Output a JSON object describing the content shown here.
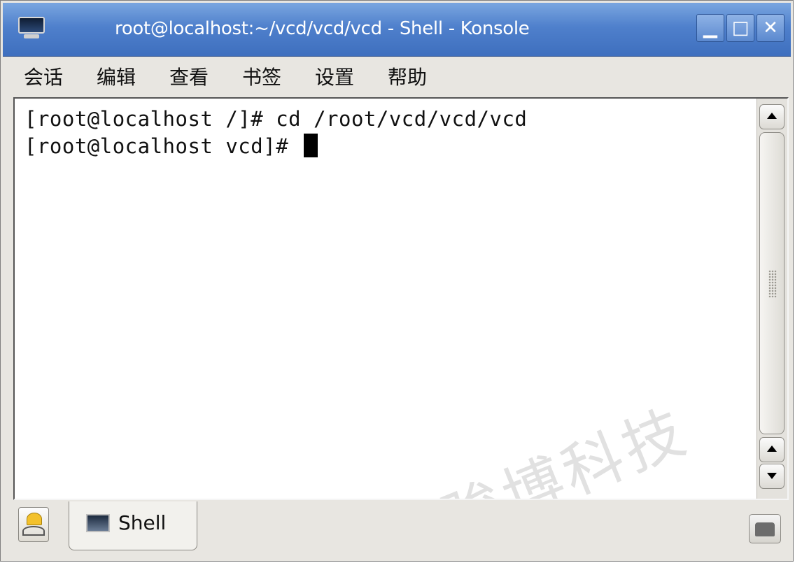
{
  "window": {
    "title": "root@localhost:~/vcd/vcd/vcd - Shell - Konsole",
    "app_icon": "terminal-monitor-icon",
    "controls": {
      "minimize": "minimize-icon",
      "maximize": "maximize-icon",
      "close": "close-icon"
    }
  },
  "menubar": {
    "items": [
      {
        "label": "会话"
      },
      {
        "label": "编辑"
      },
      {
        "label": "查看"
      },
      {
        "label": "书签"
      },
      {
        "label": "设置"
      },
      {
        "label": "帮助"
      }
    ]
  },
  "terminal": {
    "lines": [
      "[root@localhost /]# cd /root/vcd/vcd/vcd",
      "[root@localhost vcd]# "
    ],
    "watermark": "骏博科技"
  },
  "tabs": {
    "new_session_icon": "new-session-icon",
    "items": [
      {
        "label": "Shell",
        "icon": "shell-terminal-icon"
      }
    ],
    "close_icon": "close-session-icon"
  },
  "colors": {
    "titlebar": "#4f80cc",
    "terminal_background": "#ffffff",
    "terminal_text": "#111111"
  }
}
